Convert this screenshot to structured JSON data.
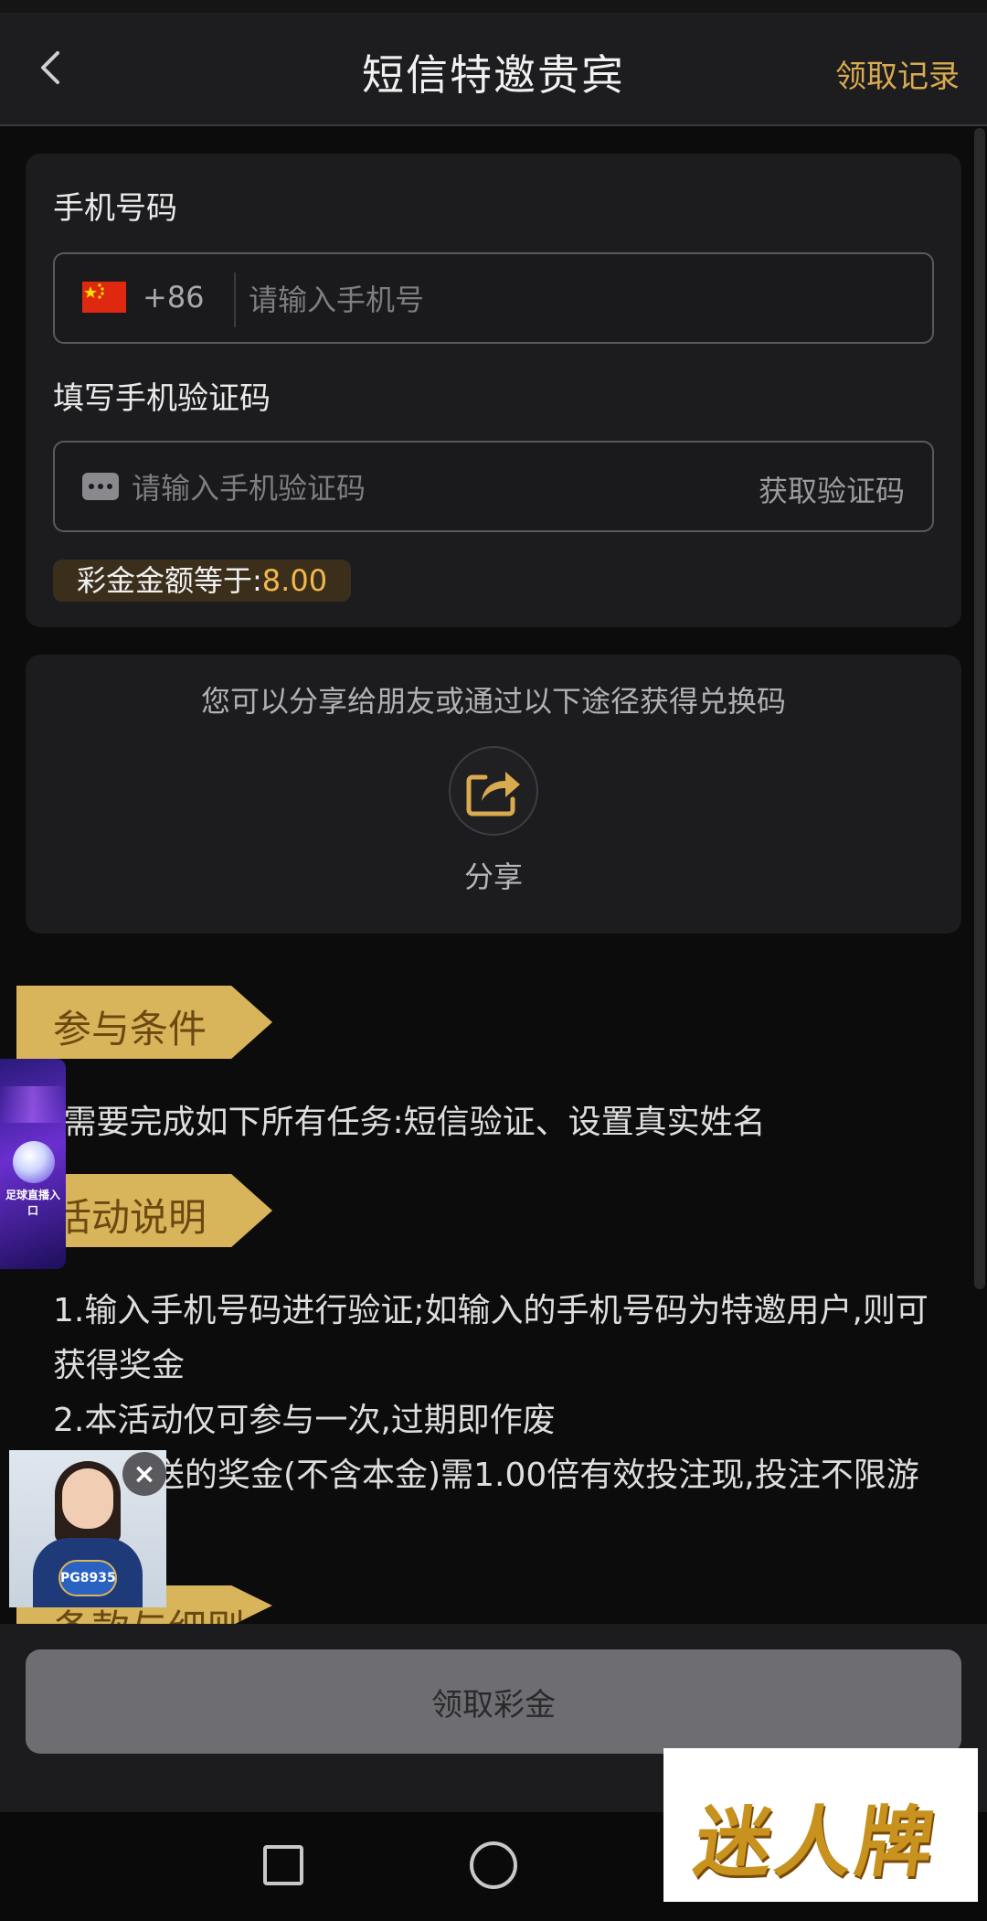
{
  "header": {
    "title": "短信特邀贵宾",
    "records_link": "领取记录"
  },
  "form": {
    "phone_label": "手机号码",
    "country_code": "+86",
    "phone_placeholder": "请输入手机号",
    "code_label": "填写手机验证码",
    "code_placeholder": "请输入手机验证码",
    "get_code": "获取验证码",
    "bonus_label": "彩金金额等于:",
    "bonus_value": "8.00"
  },
  "share": {
    "hint": "您可以分享给朋友或通过以下途径获得兑换码",
    "label": "分享"
  },
  "sections": {
    "conditions_title": "参与条件",
    "conditions_text": ".需要完成如下所有任务:短信验证、设置真实姓名",
    "description_title": "活动说明",
    "desc_1": "1.输入手机号码进行验证;如输入的手机号码为特邀用户,则可获得奖金",
    "desc_2": "2.本活动仅可参与一次,过期即作废",
    "desc_3": "动所赠送的奖金(不含本金)需1.00倍有效投注现,投注不限游戏平台",
    "terms_title": "条款与细则"
  },
  "floating": {
    "banner_text": "足球直播入口",
    "support_badge": "PG8935"
  },
  "bottom": {
    "claim_button": "领取彩金"
  },
  "watermark": {
    "text": "迷人牌"
  },
  "colors": {
    "accent_gold": "#d9aa4f",
    "bonus_value": "#f2b84b",
    "ribbon": "#d8b45a",
    "background": "#0c0c0d",
    "card": "#1c1c1e"
  }
}
